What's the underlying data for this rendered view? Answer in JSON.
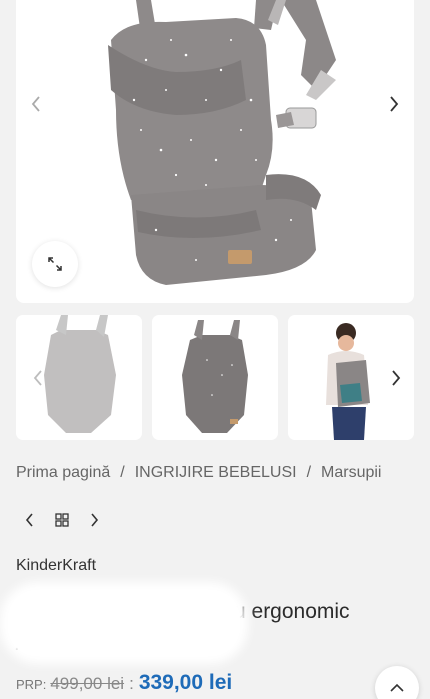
{
  "gallery": {
    "main_image_alt": "baby-carrier-gray-stars",
    "prev_icon": "chevron-left-icon",
    "next_icon": "chevron-right-icon",
    "zoom_icon": "expand-icon",
    "thumbnails": [
      {
        "name": "carrier-front-faded"
      },
      {
        "name": "carrier-front"
      },
      {
        "name": "carrier-worn-by-model"
      }
    ]
  },
  "breadcrumb": {
    "items": [
      "Prima pagină",
      "INGRIJIRE BEBELUSI",
      "Marsupii"
    ],
    "separator": "/"
  },
  "product_nav": {
    "prev_icon": "chevron-left-icon",
    "grid_icon": "grid-icon",
    "next_icon": "chevron-right-icon"
  },
  "product": {
    "brand": "KinderKraft",
    "title_visible_part": "u ergonomic",
    "title_second_line": "!"
  },
  "price": {
    "prp_label": "PRP:",
    "old_price": "499,00 lei",
    "separator": ":",
    "new_price": "339,00 lei"
  },
  "colors": {
    "background": "#f2f2f2",
    "price_blue": "#1e6bb8",
    "card": "#ffffff"
  }
}
